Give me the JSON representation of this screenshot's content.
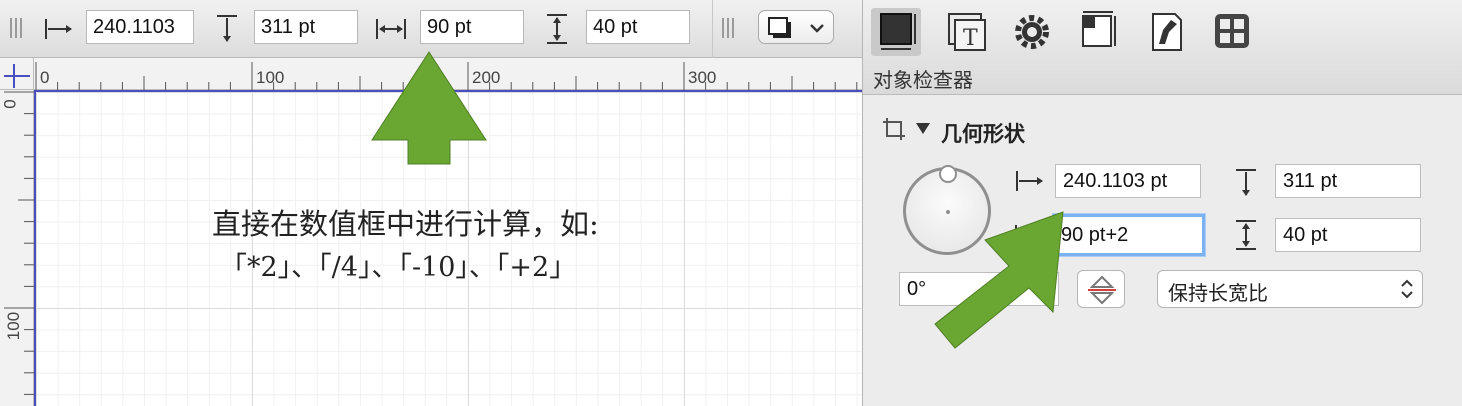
{
  "toolbar": {
    "x_value": "240.1103",
    "y_value": "311 pt",
    "width_value": "90 pt",
    "height_value": "40 pt"
  },
  "ruler": {
    "top_labels": [
      "0",
      "100",
      "200",
      "300"
    ],
    "left_labels": [
      "0",
      "100"
    ]
  },
  "canvas": {
    "line1": "直接在数值框中进行计算，如:",
    "line2": "「*2」、「/4」、「-10」、「+2」"
  },
  "inspector": {
    "title": "对象检查器",
    "tabs": [
      "geometry-tab",
      "text-tab",
      "properties-tab",
      "layout-tab",
      "style-tab",
      "canvas-tab"
    ],
    "section_title": "几何形状",
    "x_field": "240.1103 pt",
    "y_field": "311 pt",
    "width_field": "90 pt+2",
    "height_field": "40 pt",
    "rotation_field": "0°",
    "aspect_popup": "保持长宽比"
  },
  "colors": {
    "arrow_green": "#6aa632",
    "focus_ring": "#7bb3f2",
    "canvas_border": "#4a4fc0"
  }
}
